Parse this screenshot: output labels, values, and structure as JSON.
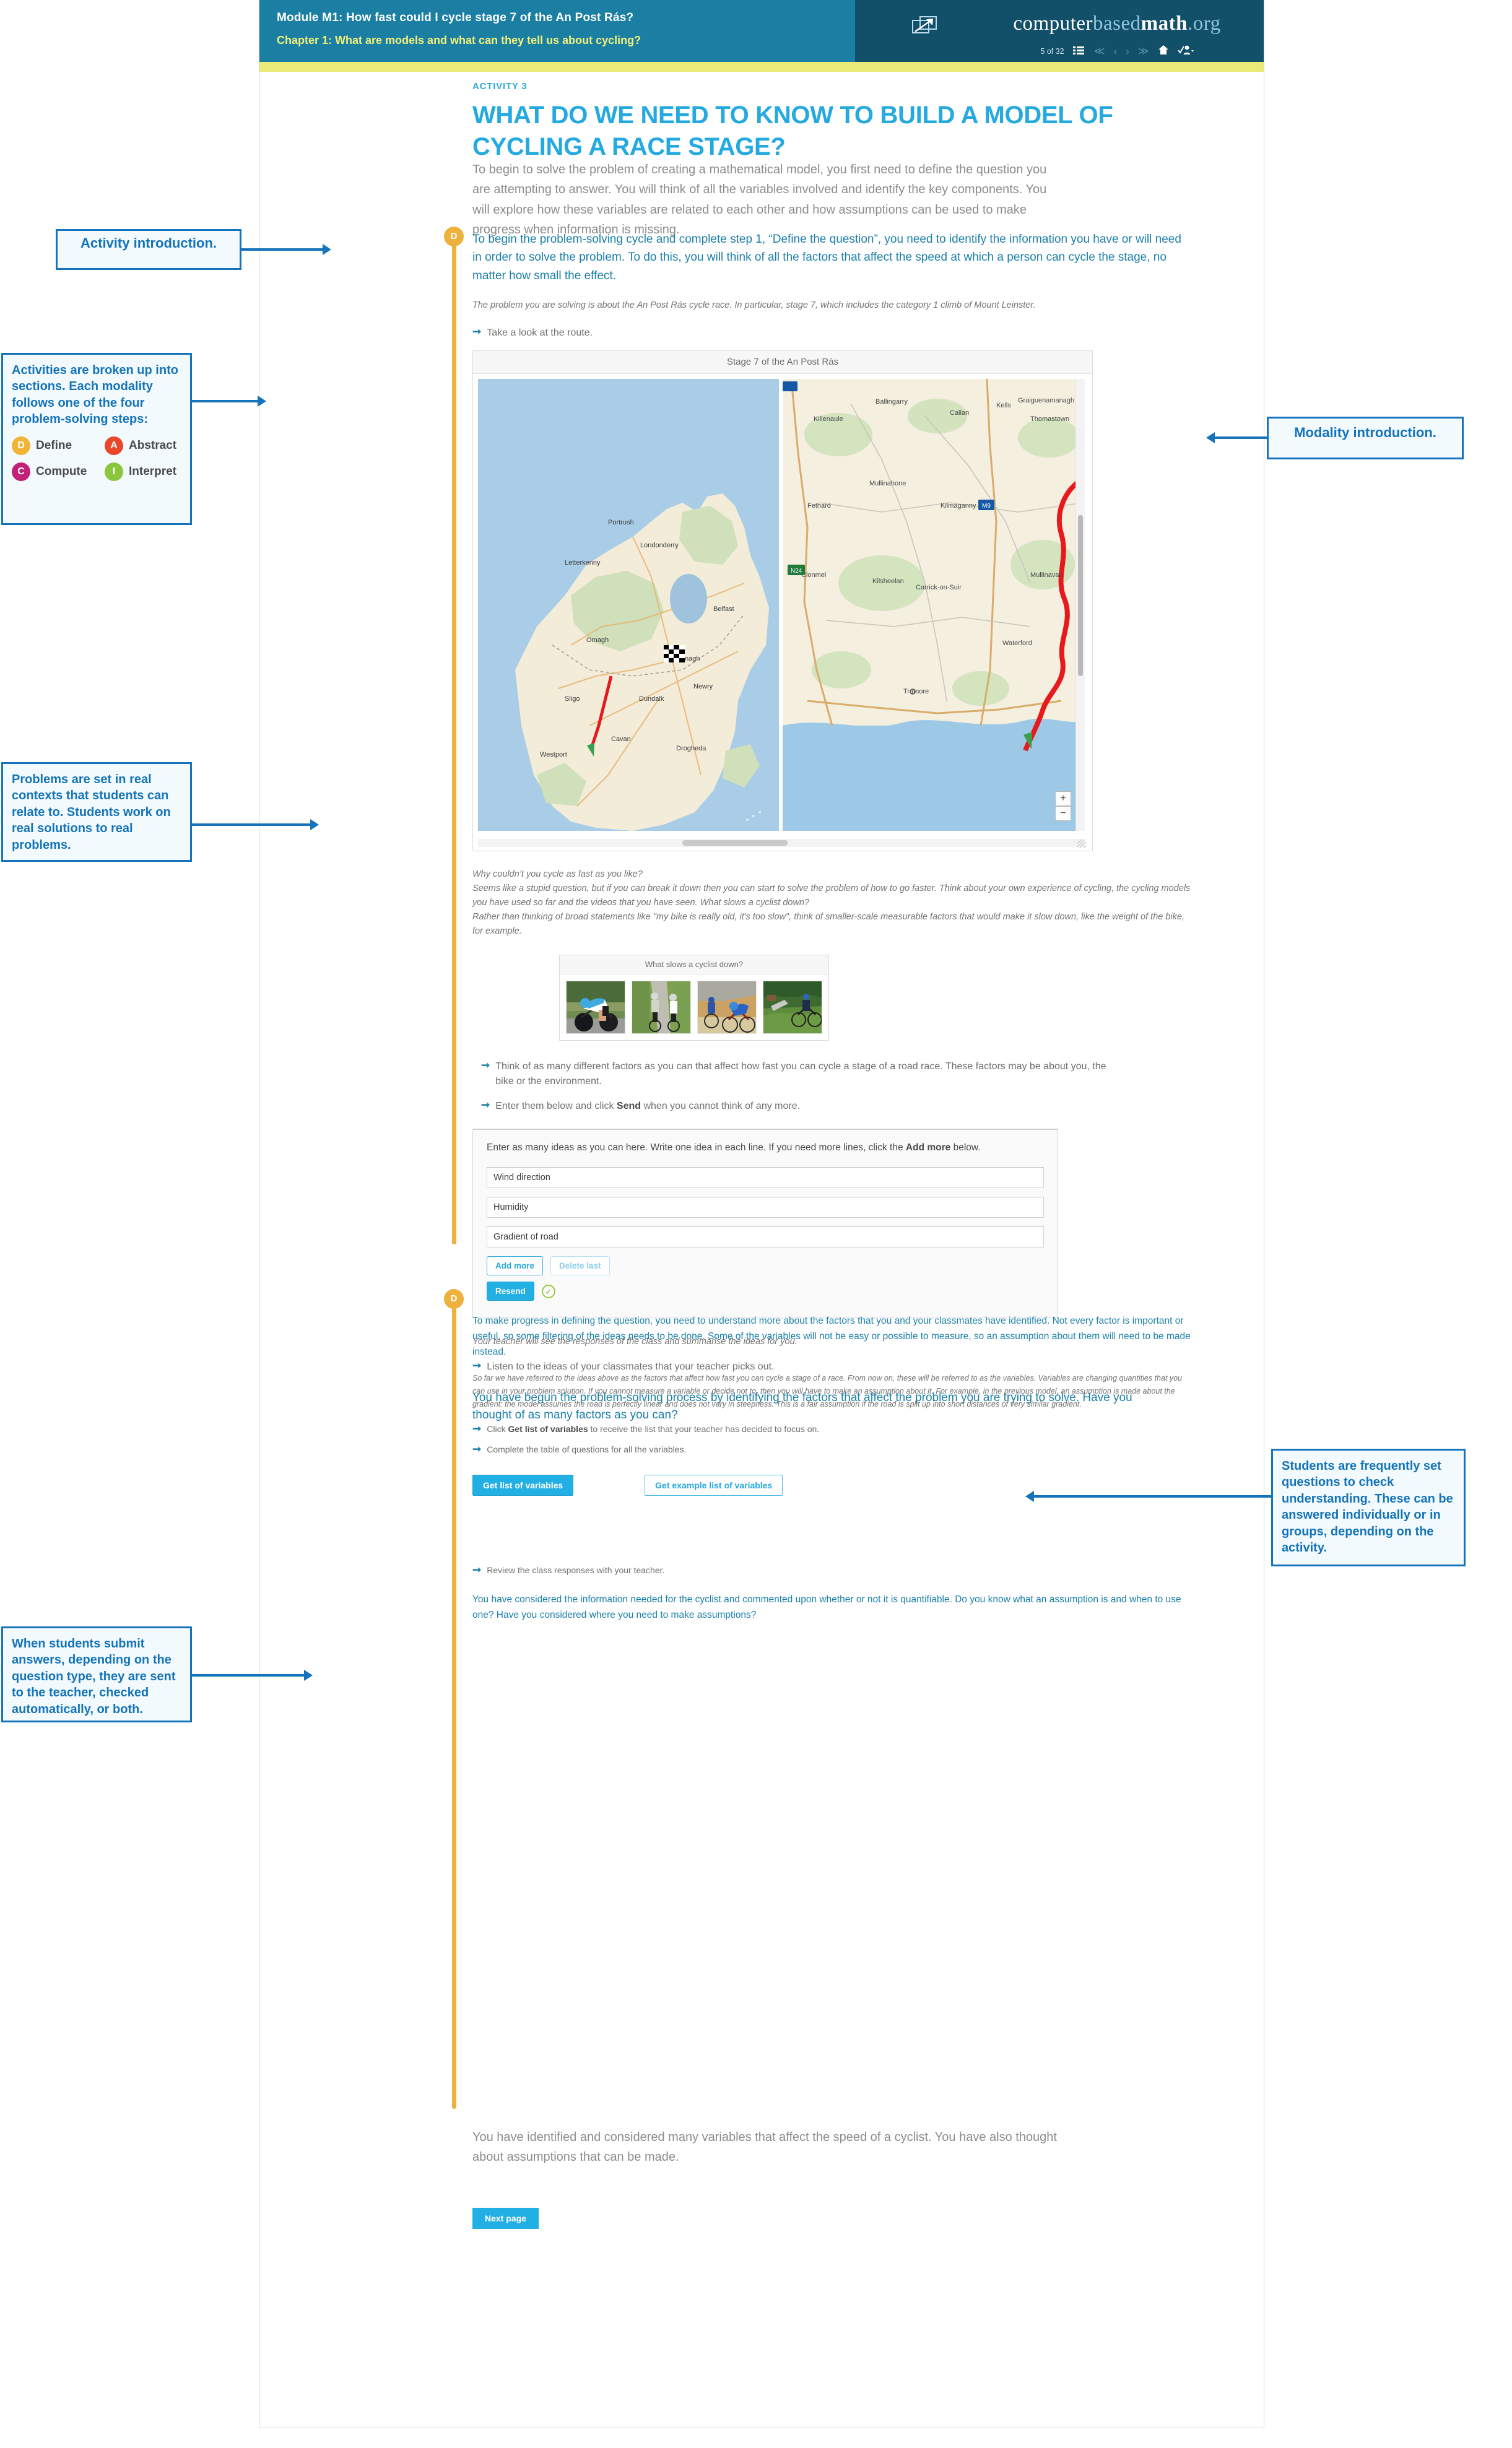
{
  "header": {
    "module_title": "Module M1: How fast could I cycle stage 7 of the An Post Rás?",
    "chapter_title": "Chapter 1: What are models and what can they tell us about cycling?",
    "brand": {
      "part1": "computer",
      "part2": "based",
      "part3": "math",
      "part4": ".org"
    },
    "page_counter": "5 of 32",
    "icons": {
      "popout": "popout-icon",
      "list": "list-icon",
      "first": "≪",
      "prev": "‹",
      "next": "›",
      "last": "≫",
      "home": "⌂",
      "user": "✓"
    }
  },
  "activity": {
    "label": "ACTIVITY 3",
    "title": "WHAT DO WE NEED TO KNOW TO BUILD A MODEL OF CYCLING A RACE STAGE?",
    "intro": "To begin to solve the problem of creating a mathematical model, you first need to define the question you are attempting to answer. You will think of all the variables involved and identify the key components. You will explore how these variables are related to each other and how assumptions can be used to make progress when information is missing."
  },
  "section1": {
    "badge": "D",
    "lead": "To begin the problem-solving cycle and complete step 1, “Define the question”, you need to identify the information you have or will need in order to solve the problem. To do this, you will think of all the factors that affect the speed at which a person can cycle the stage, no matter how small the effect.",
    "italic_note": "The problem you are solving is about the An Post Rás cycle race. In particular, stage 7, which includes the category 1 climb of Mount Leinster.",
    "instruction_route": "Take a look at the route.",
    "map_widget_title": "Stage 7 of the An Post Rás",
    "map_zoom_in": "+",
    "map_zoom_out": "−",
    "italic_block": [
      "Why couldn’t you cycle as fast as you like?",
      "Seems like a stupid question, but if you can break it down then you can start to solve the problem of how to go faster. Think about your own experience of cycling, the cycling models you have used so far and the videos that you have seen. What slows a cyclist down?",
      "Rather than thinking of broad statements like \"my bike is really old, it's too slow\", think of smaller-scale measurable factors that would make it slow down, like the weight of the bike, for example."
    ],
    "photo_widget_title": "What slows a cyclist down?",
    "instruction_factors": "Think of as many different factors as you can that affect how fast you can cycle a stage of a road race. These factors may be about you, the bike or the environment.",
    "instruction_send_pre": "Enter them below and click ",
    "instruction_send_bold": "Send",
    "instruction_send_post": " when you cannot think of any more.",
    "form": {
      "prompt_pre": "Enter as many ideas as you can here. Write one idea in each line. If you need more lines, click the ",
      "prompt_bold": "Add more",
      "prompt_post": " below.",
      "answers": [
        "Wind direction",
        "Humidity",
        "Gradient of road"
      ],
      "add_more_label": "Add more",
      "delete_last_label": "Delete last",
      "resend_label": "Resend",
      "status_icon": "check-circle-icon"
    },
    "teacher_note": "Your teacher will see the responses of the class and summarise the ideas for you.",
    "instruction_listen": "Listen to the ideas of your classmates that your teacher picks out.",
    "conclusion": "You have begun the problem-solving process by identifying the factors that affect the problem you are trying to solve. Have you thought of as many factors as you can?"
  },
  "section2": {
    "badge": "D",
    "lead": "To make progress in defining the question, you need to understand more about the factors that you and your classmates have identified. Not every factor is important or useful, so some filtering of the ideas needs to be done. Some of the variables will not be easy or possible to measure, so an assumption about them will need to be made instead.",
    "italic_note": "So far we have referred to the ideas above as the factors that affect how fast you can cycle a stage of a race. From now on, these will be referred to as the variables. Variables are changing quantities that you can use in your problem solution. If you cannot measure a variable or decide not to, then you will have to make an assumption about it. For example, in the previous model, an assumption is made about the gradient: the model assumes the road is perfectly linear and does not vary in steepness. This is a fair assumption if the road is split up into short distances of very similar gradient.",
    "instruction_click_pre": "Click ",
    "instruction_click_bold": "Get list of variables",
    "instruction_click_post": " to receive the list that your teacher has decided to focus on.",
    "instruction_table": "Complete the table of questions for all the variables.",
    "btn_get_list": "Get list of variables",
    "btn_get_example": "Get example list of variables",
    "instruction_review": "Review the class responses with your teacher.",
    "conclusion": "You have considered the information needed for the cyclist and commented upon whether or not it is quantifiable. Do you know what an assumption is and when to use one? Have you considered where you need to make assumptions?"
  },
  "footer": {
    "summary": "You have identified and considered many variables that affect the speed of a cyclist. You have also thought about assumptions that can be made.",
    "next_page_label": "Next page"
  },
  "callouts": {
    "activity_intro": "Activity introduction.",
    "modality_intro": "Modality introduction.",
    "sections": {
      "heading": "Activities are broken up into sections. Each modality follows one of the four problem-solving steps:",
      "steps": [
        {
          "letter": "D",
          "label": "Define",
          "color": "#f2b434"
        },
        {
          "letter": "A",
          "label": "Abstract",
          "color": "#e8472a"
        },
        {
          "letter": "C",
          "label": "Compute",
          "color": "#c32178"
        },
        {
          "letter": "I",
          "label": "Interpret",
          "color": "#8cc63e"
        }
      ]
    },
    "real_contexts": "Problems are set in real contexts that students can relate to. Students work on real solutions to real problems.",
    "submit_answers": "When students submit answers, depending on the question type, they are sent to the teacher, checked automatically, or both.",
    "check_understanding": "Students are frequently set questions to check understanding. These can be answered individually or in groups, depending on the activity."
  },
  "colors": {
    "brand_blue": "#24a9e0",
    "header_blue": "#1b7fa4",
    "header_dark": "#124f68",
    "yellow_bar": "#e9ea77",
    "rail_orange": "#edb13c",
    "callout_blue": "#1473ba"
  }
}
